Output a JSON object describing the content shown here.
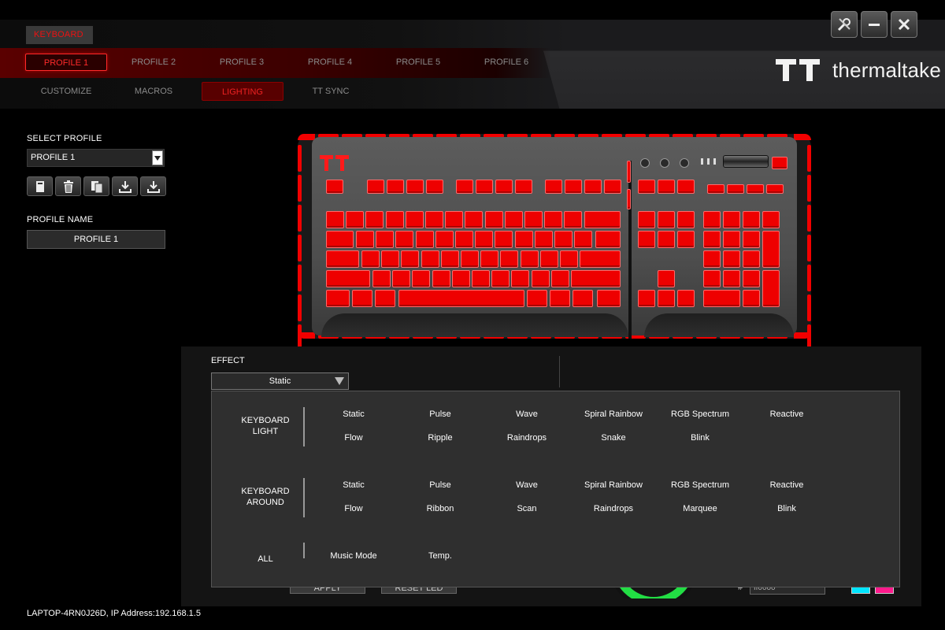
{
  "header": {
    "device_tab": "KEYBOARD",
    "profiles": [
      "PROFILE 1",
      "PROFILE 2",
      "PROFILE 3",
      "PROFILE 4",
      "PROFILE 5",
      "PROFILE 6"
    ],
    "active_profile_index": 0,
    "subtabs": [
      "CUSTOMIZE",
      "MACROS",
      "LIGHTING",
      "TT SYNC"
    ],
    "active_subtab_index": 2,
    "brand": "thermaltake",
    "window_icons": [
      "wrench-screwdriver-icon",
      "minimize-icon",
      "close-icon"
    ]
  },
  "left_panel": {
    "select_profile_label": "SELECT PROFILE",
    "select_profile_value": "PROFILE 1",
    "toolbar_icons": [
      "new-file-icon",
      "trash-icon",
      "copy-icon",
      "import-icon",
      "export-icon"
    ],
    "profile_name_label": "PROFILE NAME",
    "profile_name_value": "PROFILE 1"
  },
  "effect": {
    "label": "EFFECT",
    "selected": "Static",
    "groups": [
      {
        "label_lines": [
          "KEYBOARD",
          "LIGHT"
        ],
        "rows": [
          [
            "Static",
            "Pulse",
            "Wave",
            "Spiral Rainbow",
            "RGB Spectrum",
            "Reactive"
          ],
          [
            "Flow",
            "Ripple",
            "Raindrops",
            "Snake",
            "Blink"
          ]
        ]
      },
      {
        "label_lines": [
          "KEYBOARD",
          "AROUND"
        ],
        "rows": [
          [
            "Static",
            "Pulse",
            "Wave",
            "Spiral Rainbow",
            "RGB Spectrum",
            "Reactive"
          ],
          [
            "Flow",
            "Ribbon",
            "Scan",
            "Raindrops",
            "Marquee",
            "Blink"
          ]
        ]
      },
      {
        "label_lines": [
          "ALL"
        ],
        "rows": [
          [
            "Music Mode",
            "Temp."
          ]
        ]
      }
    ]
  },
  "hidden_controls": {
    "apply_label": "APPLY",
    "reset_label": "RESET LED",
    "hash": "#",
    "hex_value": "ff0000"
  },
  "swatch_colors": [
    "#00e5ff",
    "#ff1a8c"
  ],
  "status_bar": "LAPTOP-4RN0J26D, IP Address:192.168.1.5",
  "colors": {
    "accent_red": "#ff0000",
    "panel": "#2f2f2f"
  }
}
